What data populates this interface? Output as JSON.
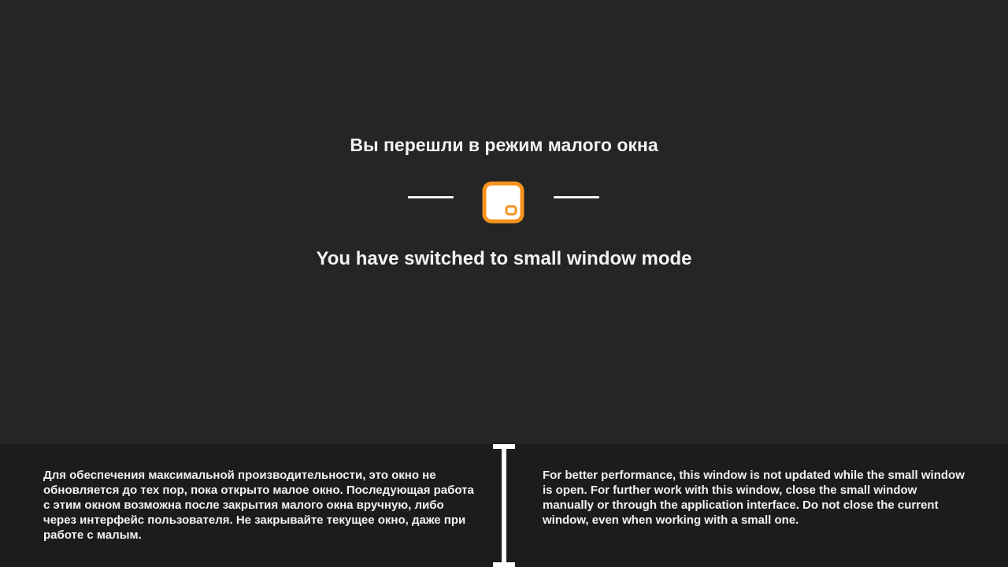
{
  "main": {
    "title_ru": "Вы перешли в режим малого окна",
    "title_en": "You have switched to small window mode",
    "icon": "small-window-mode-icon",
    "accent_color": "#f7931e"
  },
  "footer": {
    "text_ru": "Для обеспечения максимальной производительности, это окно не обновляется до тех пор, пока открыто малое окно. Последующая работа с этим окном возможна после закрытия малого окна вручную, либо через интерфейс пользователя. Не закрывайте текущее окно, даже при работе с малым.",
    "text_en": "For better performance, this window is not updated while the small window is open. For further work with this window, close the small window manually or through the application interface. Do not close the current window, even when working with a small one."
  }
}
